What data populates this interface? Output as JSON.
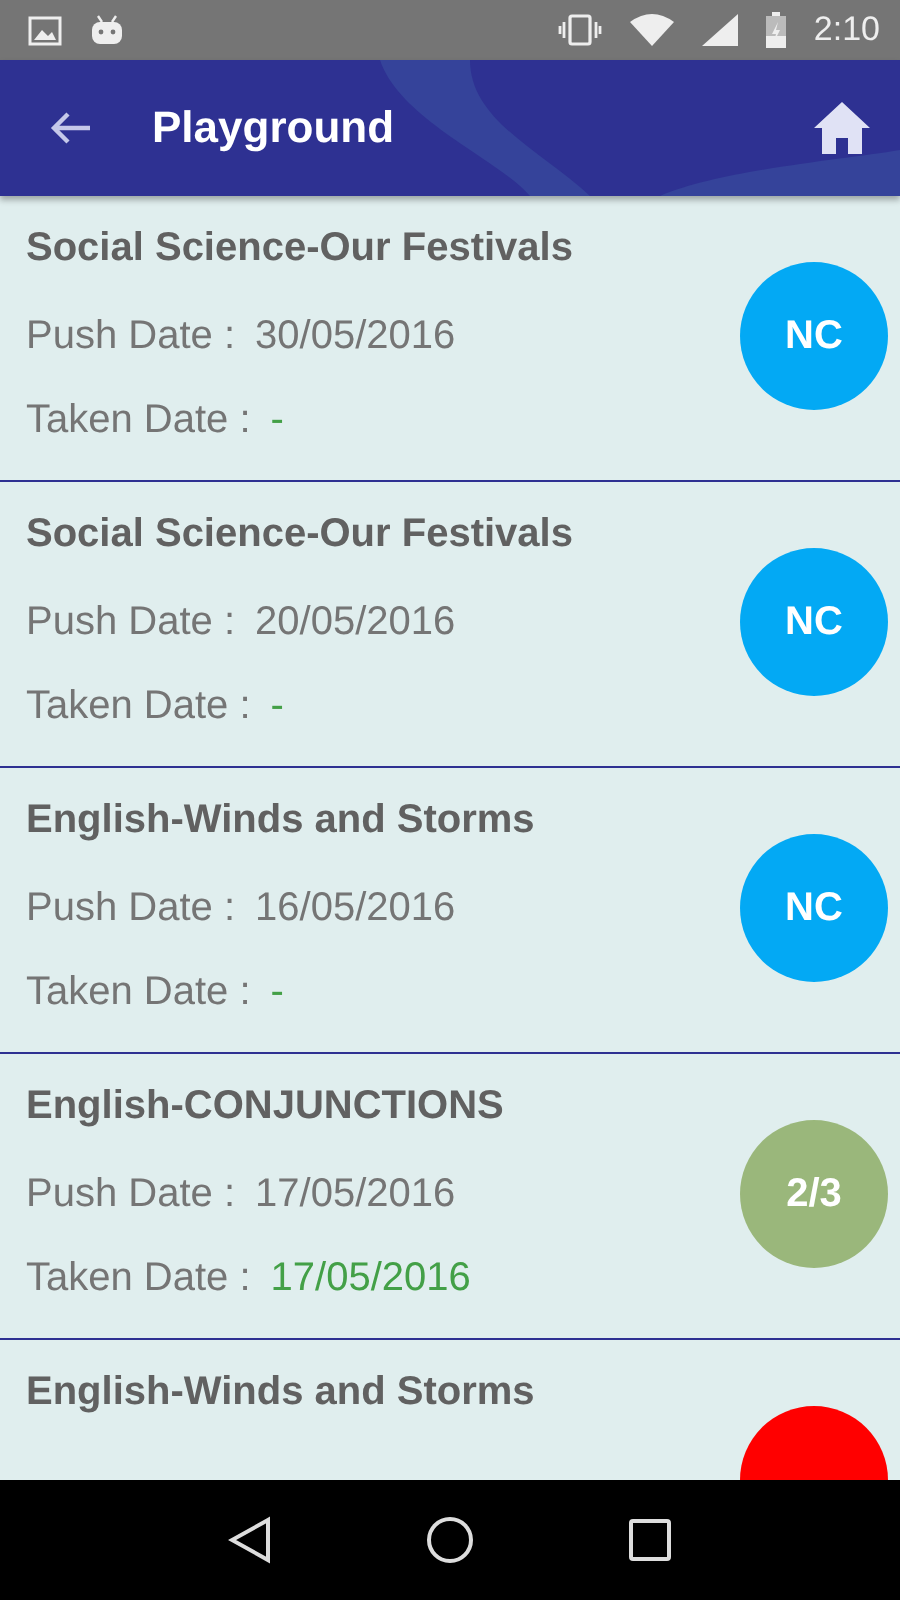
{
  "status_bar": {
    "time": "2:10"
  },
  "app_bar": {
    "title": "Playground"
  },
  "items": [
    {
      "title": "Social Science-Our Festivals",
      "push_label": "Push Date :",
      "push_date": "30/05/2016",
      "taken_label": "Taken Date :",
      "taken_date": "-",
      "badge": "NC",
      "color": "#03a9f4"
    },
    {
      "title": "Social Science-Our Festivals",
      "push_label": "Push Date :",
      "push_date": "20/05/2016",
      "taken_label": "Taken Date :",
      "taken_date": "-",
      "badge": "NC",
      "color": "#03a9f4"
    },
    {
      "title": "English-Winds and Storms",
      "push_label": "Push Date :",
      "push_date": "16/05/2016",
      "taken_label": "Taken Date :",
      "taken_date": "-",
      "badge": "NC",
      "color": "#03a9f4"
    },
    {
      "title": "English-CONJUNCTIONS",
      "push_label": "Push Date :",
      "push_date": "17/05/2016",
      "taken_label": "Taken Date :",
      "taken_date": "17/05/2016",
      "badge": "2/3",
      "color": "#9ab77b"
    },
    {
      "title": "English-Winds and Storms",
      "color": "#ff0000"
    }
  ]
}
